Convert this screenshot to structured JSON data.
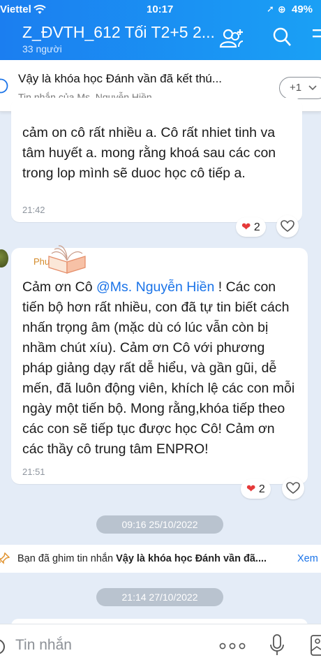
{
  "status_bar": {
    "carrier": "Viettel",
    "time": "10:17",
    "battery": "49%"
  },
  "header": {
    "title": "Z_ĐVTH_612 Tối T2+5 2...",
    "members": "33 người"
  },
  "pinned": {
    "message": "Vậy là khóa học Đánh vần đã kết thú...",
    "from": "Tin nhắn của Ms. Nguyễn Hiền",
    "more_label": "+1"
  },
  "messages": [
    {
      "text": "cảm on cô rất nhiều a. Cô rất nhiet tinh va tâm huyết a. mong rằng khoá sau các con trong lop mình sẽ duoc học cô tiếp a.",
      "time": "21:42",
      "reaction_count": "2"
    },
    {
      "sender": "Phượ",
      "text_before": "Cảm ơn Cô ",
      "mention": "@Ms. Nguyễn Hiền",
      "text_after": " ! Các con tiến bộ hơn rất nhiều, con đã tự tin biết cách nhấn trọng âm (mặc dù có lúc vẫn còn bị nhầm chút xíu). Cảm ơn Cô với phương pháp giảng dạy rất dễ hiểu, và gần gũi, dễ mến, đã luôn động viên, khích lệ các con mỗi ngày một tiến bộ. Mong rằng,khóa tiếp theo các con sẽ tiếp tục được học Cô! Cảm ơn các thầy cô trung tâm ENPRO!",
      "time": "21:51",
      "reaction_count": "2"
    }
  ],
  "date_chips": [
    "09:16 25/10/2022",
    "21:14 27/10/2022"
  ],
  "pin_notice": {
    "prefix": "Bạn đã ghim tin nhắn",
    "message": "Vậy là khóa học Đánh vần đã....",
    "link": "Xem"
  },
  "composer": {
    "placeholder": "Tin nhắn"
  },
  "colors": {
    "header_start": "#1b7ef0",
    "header_end": "#1aa0f5",
    "background": "#e4ecf7",
    "mention": "#1a73e8"
  }
}
